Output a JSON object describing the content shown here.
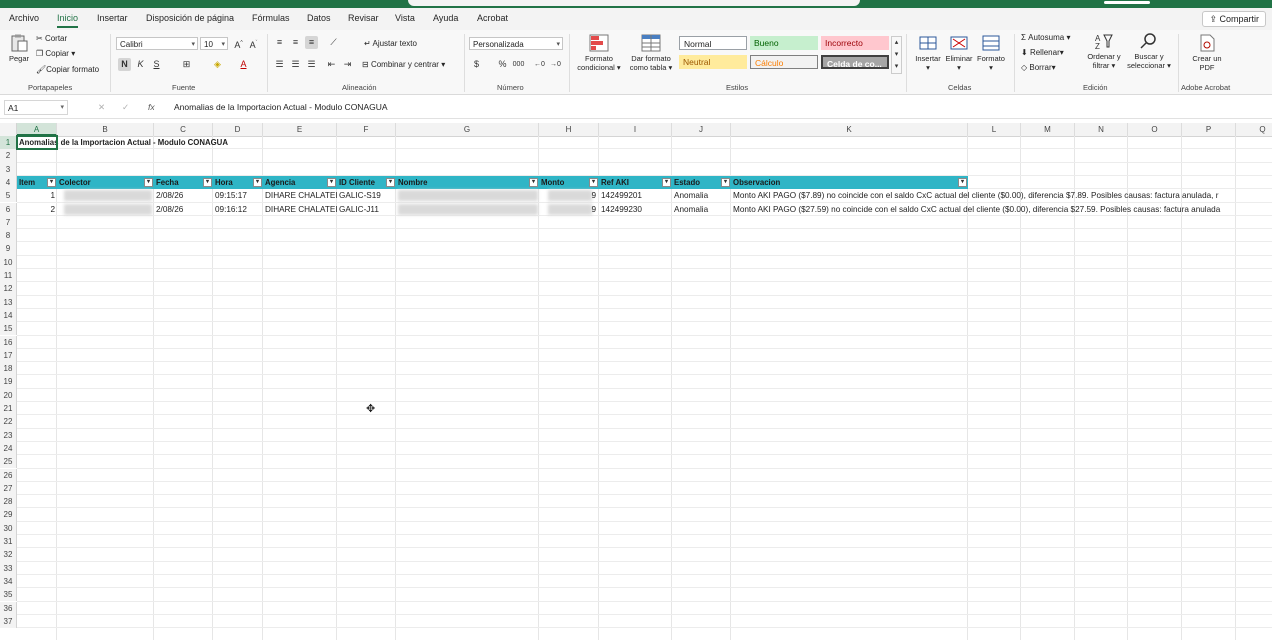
{
  "menu": {
    "tabs": [
      "Archivo",
      "Inicio",
      "Insertar",
      "Disposición de página",
      "Fórmulas",
      "Datos",
      "Revisar",
      "Vista",
      "Ayuda",
      "Acrobat"
    ],
    "active_tab": "Inicio",
    "share_label": "Compartir"
  },
  "ribbon": {
    "clipboard": {
      "paste": "Pegar",
      "cut": "Cortar",
      "copy": "Copiar",
      "format_painter": "Copiar formato",
      "label": "Portapapeles"
    },
    "font": {
      "name": "Calibri",
      "size": "10",
      "bold": "N",
      "italic": "K",
      "underline": "S",
      "label": "Fuente"
    },
    "alignment": {
      "wrap": "Ajustar texto",
      "merge": "Combinar y centrar",
      "label": "Alineación"
    },
    "number": {
      "format": "Personalizada",
      "label": "Número"
    },
    "styles": {
      "conditional": "Formato condicional",
      "as_table": "Dar formato como tabla",
      "normal": "Normal",
      "good": "Bueno",
      "bad": "Incorrecto",
      "neutral": "Neutral",
      "calc": "Cálculo",
      "check": "Celda de co...",
      "label": "Estilos"
    },
    "cells": {
      "insert": "Insertar",
      "delete": "Eliminar",
      "format": "Formato",
      "label": "Celdas"
    },
    "editing": {
      "autosum": "Autosuma",
      "fill": "Rellenar",
      "clear": "Borrar",
      "sort": "Ordenar y filtrar",
      "find": "Buscar y seleccionar",
      "label": "Edición"
    },
    "acrobat": {
      "create_pdf": "Crear un PDF",
      "label": "Adobe Acrobat"
    }
  },
  "formula_bar": {
    "name_box": "A1",
    "formula": "Anomalias de la Importacion Actual - Modulo CONAGUA"
  },
  "sheet": {
    "columns": [
      "A",
      "B",
      "C",
      "D",
      "E",
      "F",
      "G",
      "H",
      "I",
      "J",
      "K",
      "L",
      "M",
      "N",
      "O",
      "P",
      "Q"
    ],
    "rows": [
      "1",
      "2",
      "3",
      "4",
      "5",
      "6",
      "7",
      "8",
      "9",
      "10",
      "11",
      "12",
      "13",
      "14",
      "15",
      "16",
      "17",
      "18",
      "19",
      "20",
      "21",
      "22",
      "23",
      "24",
      "25",
      "26",
      "27",
      "28",
      "29",
      "30",
      "31",
      "32",
      "33",
      "34",
      "35",
      "36",
      "37"
    ],
    "title": "Anomalias de la Importacion Actual - Modulo CONAGUA",
    "headers": [
      "Item",
      "Colector",
      "Fecha",
      "Hora",
      "Agencia",
      "ID Cliente",
      "Nombre",
      "Monto",
      "Ref AKI",
      "Estado",
      "Observacion"
    ],
    "data": [
      {
        "item": "1",
        "fecha": "2/08/26",
        "hora": "09:15:17",
        "agencia": "DIHARE CHALATEI",
        "id": "GALIC-S19",
        "monto": "9",
        "ref": "142499201",
        "estado": "Anomalia",
        "obs": "Monto AKI PAGO ($7.89) no coincide con el saldo CxC actual del cliente ($0.00), diferencia $7.89. Posibles causas: factura anulada, r"
      },
      {
        "item": "2",
        "fecha": "2/08/26",
        "hora": "09:16:12",
        "agencia": "DIHARE CHALATEI",
        "id": "GALIC-J11",
        "monto": "9",
        "ref": "142499230",
        "estado": "Anomalia",
        "obs": "Monto AKI PAGO ($27.59) no coincide con el saldo CxC actual del cliente ($0.00), diferencia $27.59. Posibles causas: factura anulada"
      }
    ]
  },
  "colors": {
    "accent": "#217346",
    "table_header": "#2fb5c6"
  }
}
